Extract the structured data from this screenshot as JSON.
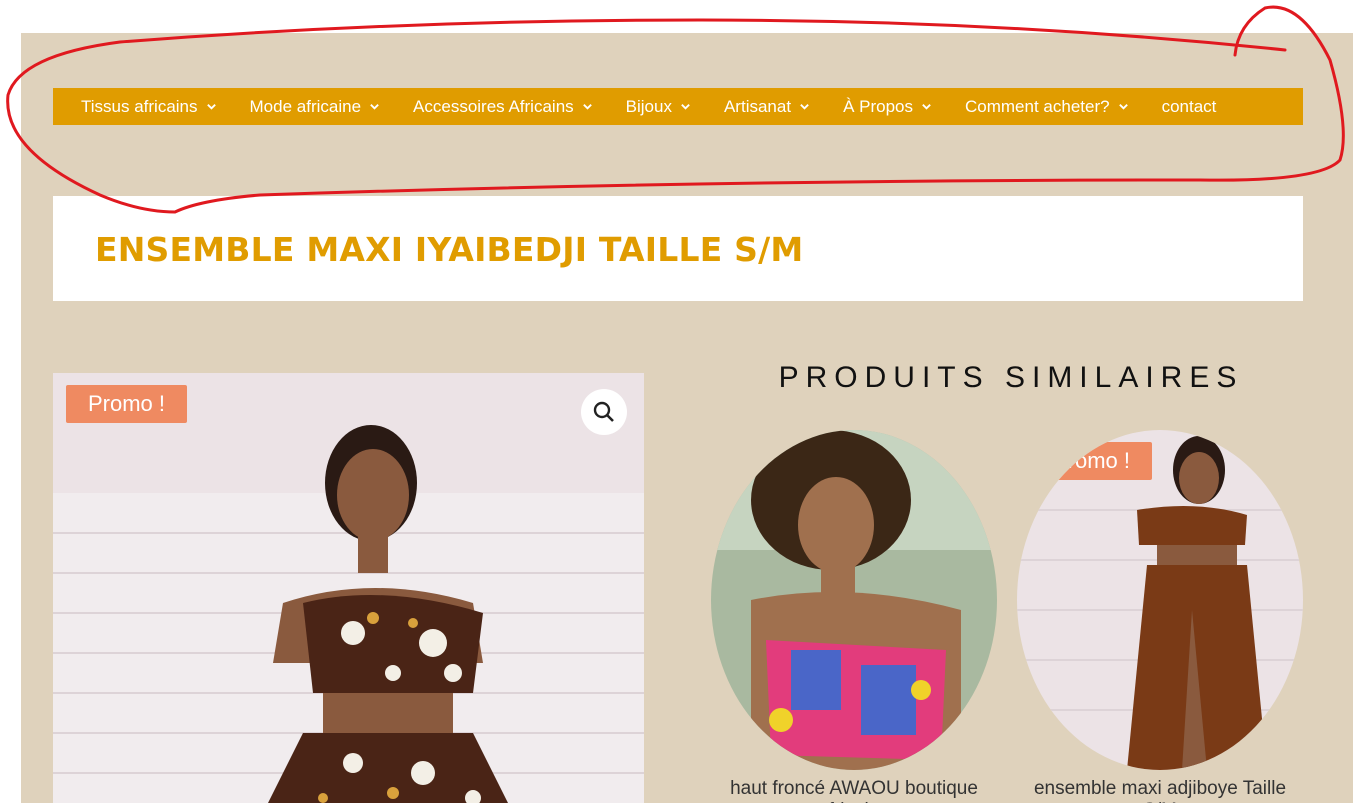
{
  "colors": {
    "page_bg": "#dfd2bc",
    "accent": "#e09c00",
    "promo": "#ef8a61",
    "annotation": "#e0191f"
  },
  "nav": {
    "items": [
      {
        "label": "Tissus africains",
        "dropdown": true
      },
      {
        "label": "Mode africaine",
        "dropdown": true
      },
      {
        "label": "Accessoires Africains",
        "dropdown": true
      },
      {
        "label": "Bijoux",
        "dropdown": true
      },
      {
        "label": "Artisanat",
        "dropdown": true
      },
      {
        "label": "À Propos",
        "dropdown": true
      },
      {
        "label": "Comment acheter?",
        "dropdown": true
      },
      {
        "label": "contact",
        "dropdown": false
      }
    ]
  },
  "product": {
    "title": "ENSEMBLE MAXI IYAIBEDJI TAILLE S/M",
    "badge": "Promo !",
    "zoom_icon": "magnifier-icon"
  },
  "related": {
    "heading": "PRODUITS SIMILAIRES",
    "items": [
      {
        "name": "haut froncé AWAOU boutique africaine",
        "badge": ""
      },
      {
        "name": "ensemble maxi adjiboye Taille S/M",
        "badge": "Promo !"
      }
    ]
  }
}
